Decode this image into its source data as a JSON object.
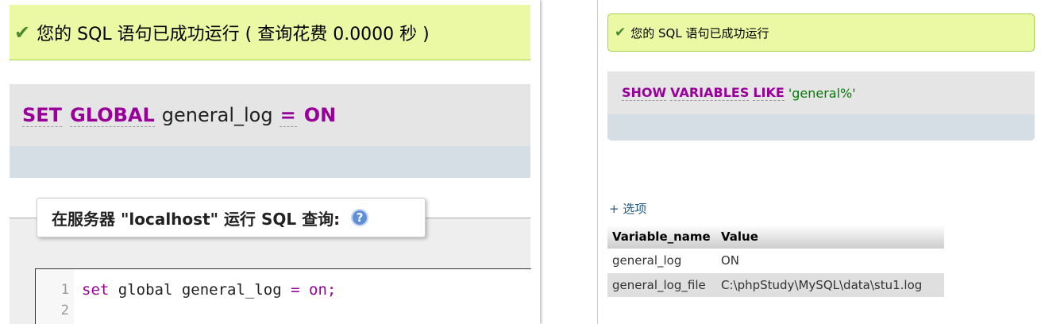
{
  "left": {
    "success_message": "您的 SQL 语句已成功运行 ( 查询花费 0.0000 秒 )",
    "sql": {
      "kw1": "SET",
      "kw2": "GLOBAL",
      "ident": "general_log",
      "op": "=",
      "value": "ON"
    },
    "legend_title": "在服务器 \"localhost\" 运行 SQL 查询:",
    "help_icon": "help-icon",
    "editor": {
      "line_numbers": [
        "1",
        "2"
      ],
      "code": {
        "kw1": "set",
        "rest": " global general_log ",
        "op": "=",
        "space": " ",
        "value": "on",
        "end": ";"
      }
    }
  },
  "right": {
    "success_message": "您的 SQL 语句已成功运行",
    "sql": {
      "kw1": "SHOW",
      "kw2": "VARIABLES",
      "kw3": "LIKE",
      "string": "'general%'"
    },
    "options_link": "+ 选项",
    "table": {
      "headers": [
        "Variable_name",
        "Value"
      ],
      "rows": [
        [
          "general_log",
          "ON"
        ],
        [
          "general_log_file",
          "C:\\phpStudy\\MySQL\\data\\stu1.log"
        ]
      ]
    }
  },
  "colors": {
    "success_bg": "#ebf8a4",
    "keyword": "#990099",
    "string": "#008000",
    "link": "#235a81"
  }
}
